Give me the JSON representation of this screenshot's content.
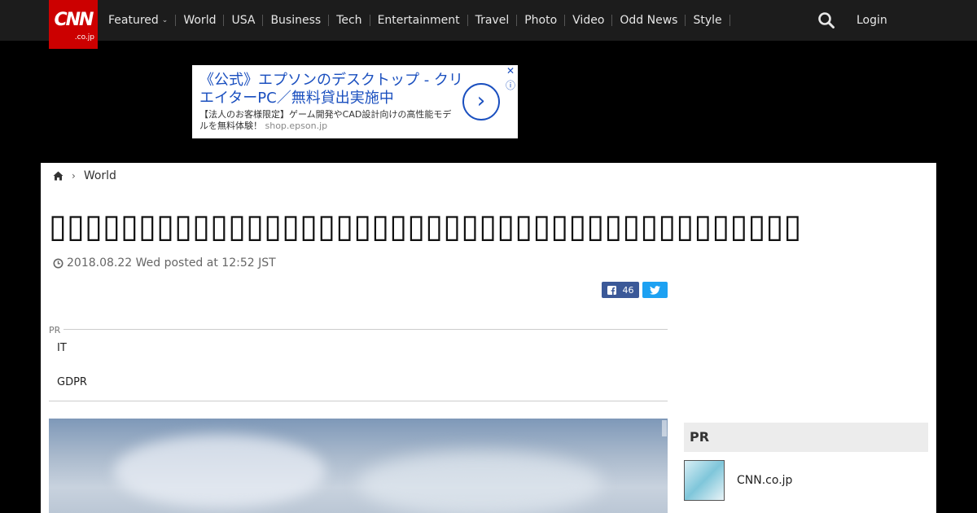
{
  "header": {
    "logo_main": "CNN",
    "logo_sub": ".co.jp",
    "nav": [
      {
        "label": "Featured",
        "has_dropdown": true
      },
      {
        "label": "World"
      },
      {
        "label": "USA"
      },
      {
        "label": "Business"
      },
      {
        "label": "Tech"
      },
      {
        "label": "Entertainment"
      },
      {
        "label": "Travel"
      },
      {
        "label": "Photo"
      },
      {
        "label": "Video"
      },
      {
        "label": "Odd News"
      },
      {
        "label": "Style"
      }
    ],
    "search_icon": "search-icon",
    "login": "Login"
  },
  "ad": {
    "headline": "《公式》エプソンのデスクトップ - クリエイターPC／無料貸出実施中",
    "body": "【法人のお客様限定】ゲーム開発やCAD設計向けの高性能モデルを無料体験！",
    "domain": "shop.epson.jp",
    "arrow": "›",
    "close": "✕",
    "info": "ⓘ"
  },
  "breadcrumb": {
    "home_icon": "home-icon",
    "section": "World"
  },
  "article": {
    "title": "▯▯▯▯▯▯▯▯▯▯▯▯▯▯▯▯▯▯▯▯▯▯▯▯▯▯▯▯▯▯▯▯▯▯▯▯▯▯▯▯▯▯",
    "date": "2018.08.22 Wed posted at 12:52 JST",
    "facebook_count": "46"
  },
  "pr_block": {
    "label": "PR",
    "items": [
      "IT",
      "GDPR"
    ]
  },
  "sidebar": {
    "pr_heading": "PR",
    "item_label": "CNN.co.jp"
  },
  "colors": {
    "brand_red": "#cc0000",
    "facebook": "#3b5998",
    "twitter": "#1da1f2",
    "ad_blue": "#1a4fbf"
  }
}
